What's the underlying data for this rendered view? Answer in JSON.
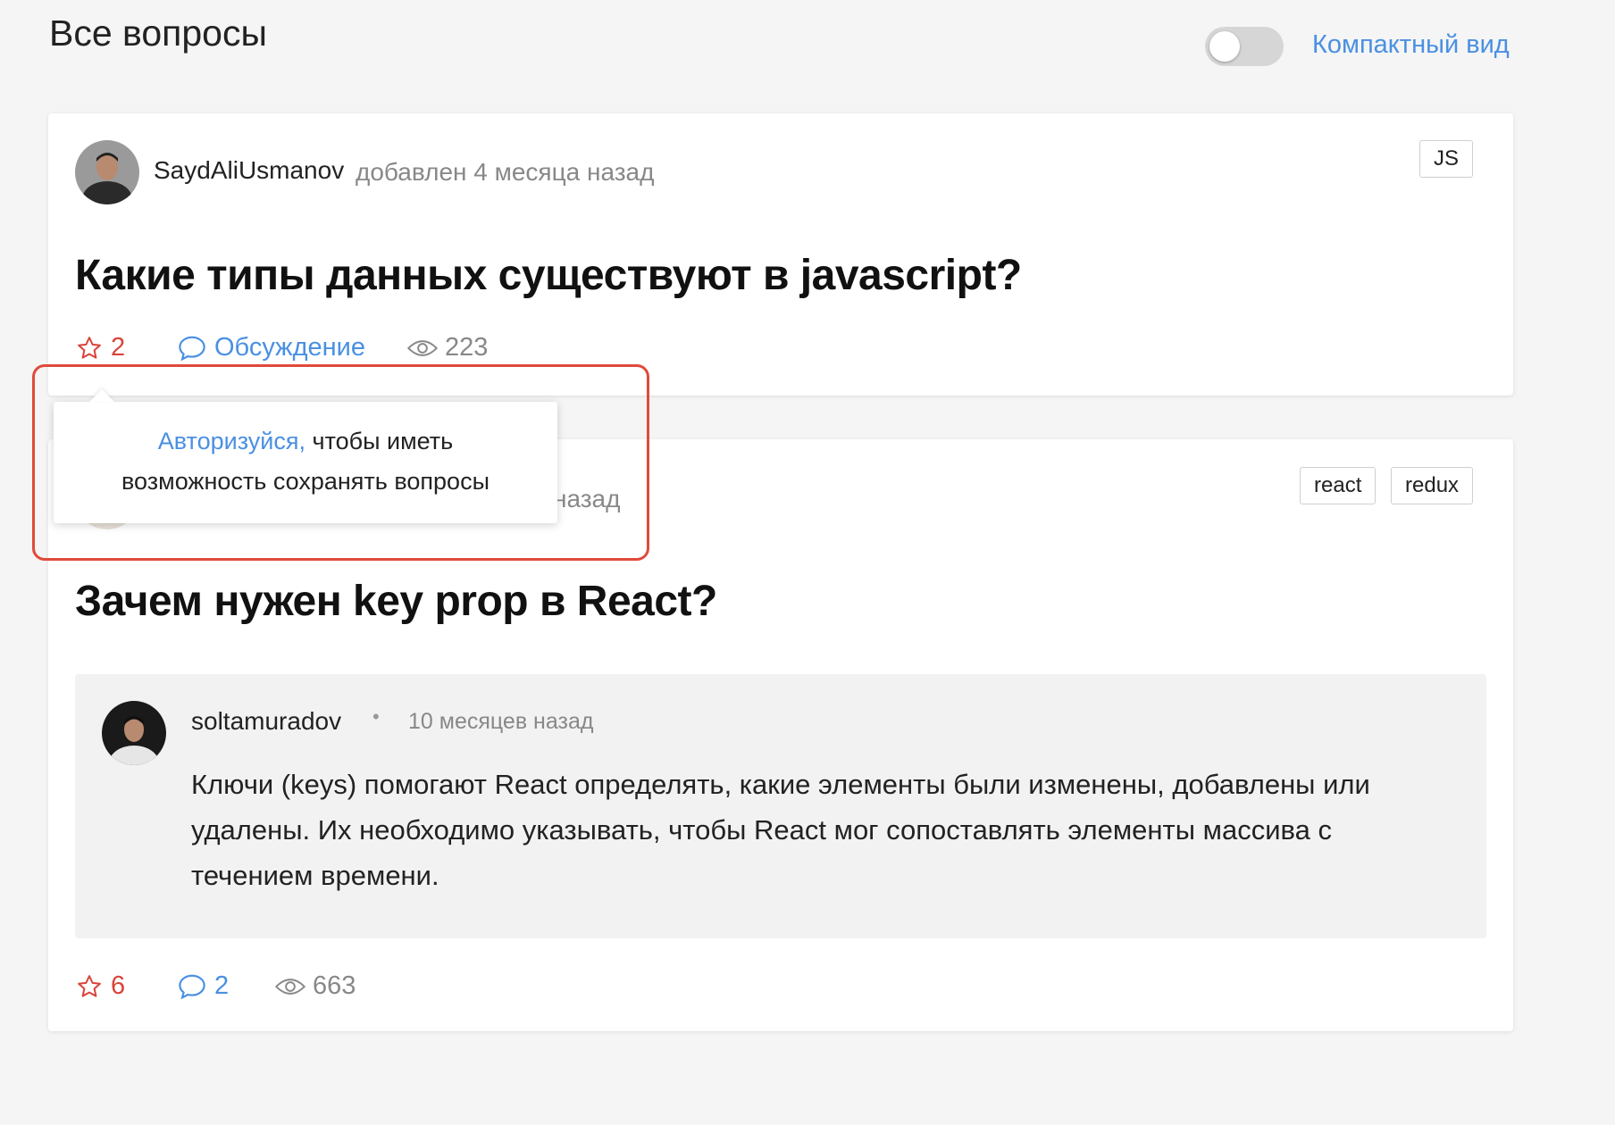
{
  "header": {
    "title": "Все вопросы",
    "compact_view_label": "Компактный вид"
  },
  "questions": [
    {
      "author": "SaydAliUsmanov",
      "meta": "добавлен 4 месяца назад",
      "tags": [
        "JS"
      ],
      "title": "Какие типы данных существуют в javascript?",
      "stats": {
        "stars": "2",
        "comments": "Обсуждение",
        "views": "223"
      }
    },
    {
      "meta_visible": "назад",
      "tags": [
        "react",
        "redux"
      ],
      "title": "Зачем нужен key prop в React?",
      "answer": {
        "author": "soltamuradov",
        "separator": "•",
        "time": "10 месяцев назад",
        "text": "Ключи (keys) помогают React определять, какие элементы были изменены, добавлены или удалены. Их необходимо указывать, чтобы React мог сопоставлять элементы массива с течением времени."
      },
      "stats": {
        "stars": "6",
        "comments": "2",
        "views": "663"
      }
    }
  ],
  "tooltip": {
    "link_text": "Авторизуйся,",
    "text_line1": " чтобы иметь",
    "text_line2": "возможность сохранять вопросы"
  },
  "colors": {
    "accent": "#4a90e2",
    "star": "#d9433a",
    "highlight": "#e04a3a"
  },
  "icons": [
    "star-icon",
    "comment-icon",
    "eye-icon"
  ]
}
